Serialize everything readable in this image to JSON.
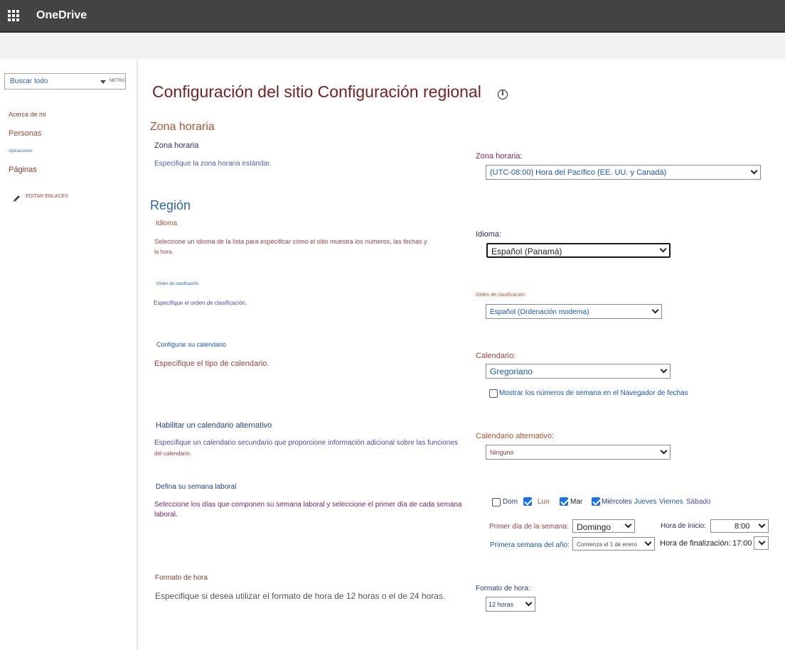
{
  "app": {
    "title": "OneDrive"
  },
  "search": {
    "placeholder": "Buscar todo",
    "scope": "METRO"
  },
  "nav": {
    "about": "Acerca de mi",
    "people": "Personas",
    "apps": "Aplicaciones",
    "pages": "Páginas",
    "edit_links": "EDITAR ENLACES"
  },
  "page": {
    "title": "Configuración del sitio Configuración regional",
    "info_icon": "i"
  },
  "time_zone": {
    "section_title": "Zona horaria",
    "label": "Zona horaria",
    "description": "Especifique la zona horaria estándar.",
    "field_label": "Zona horaria:",
    "value": "(UTC-08:00) Hora del Pacífico (EE. UU. y Canadá)"
  },
  "region": {
    "section_title": "Región",
    "language": {
      "label": "Idioma",
      "description_line1": "Seleccione un idioma de la lista para especificar cómo el sitio muestra los números, las fechas y",
      "description_line2": "la hora.",
      "field_label": "Idioma:",
      "value": "Español (Panamá)"
    },
    "sort_order": {
      "label": "Orden de clasificación",
      "description": "Especifique el orden de clasificación.",
      "field_label": "Orden de clasificación:",
      "value": "Español (Ordenación moderna)"
    },
    "calendar": {
      "label": "Configurar su calendario",
      "description": "Especifique el tipo de calendario.",
      "field_label": "Calendario:",
      "value": "Gregoriano",
      "week_numbers_label": "Mostrar los números de semana en el Navegador de fechas",
      "week_numbers_checked": false
    },
    "alt_calendar": {
      "label": "Habilitar un calendario alternativo",
      "description_line1": "Especifique un calendario secundario que proporcione información adicional sobre las funciones",
      "description_line2": "del calendario.",
      "field_label": "Calendario alternativo:",
      "value": "Ninguno"
    },
    "work_week": {
      "label": "Defina su semana laboral",
      "description_line1": "Seleccione los días que componen su semana laboral y seleccione el primer día de cada semana",
      "description_line2": "laboral.",
      "days": [
        {
          "label": "Dom",
          "checked": false
        },
        {
          "label": "Lun",
          "checked": true
        },
        {
          "label": "Mar",
          "checked": true
        },
        {
          "label": "Miércoles",
          "checked": true
        },
        {
          "label": "Jueves",
          "checked": true
        },
        {
          "label": "Viernes",
          "checked": true
        },
        {
          "label": "Sábado",
          "checked": false
        }
      ],
      "first_day_label": "Primer día de la semana:",
      "first_day_value": "Domingo",
      "start_time_label": "Hora de inicio:",
      "start_time_value": "8:00",
      "first_week_label": "Primera semana del año:",
      "first_week_value": "Comienza el 1 de enero",
      "end_time_label": "Hora de finalización:",
      "end_time_value": "17:00"
    },
    "time_format": {
      "label": "Formato de hora",
      "description": "Especifique si desea utilizar el formato de hora de 12 horas o el de 24 horas.",
      "field_label": "Formato de hora:",
      "value": "12 horas"
    }
  }
}
